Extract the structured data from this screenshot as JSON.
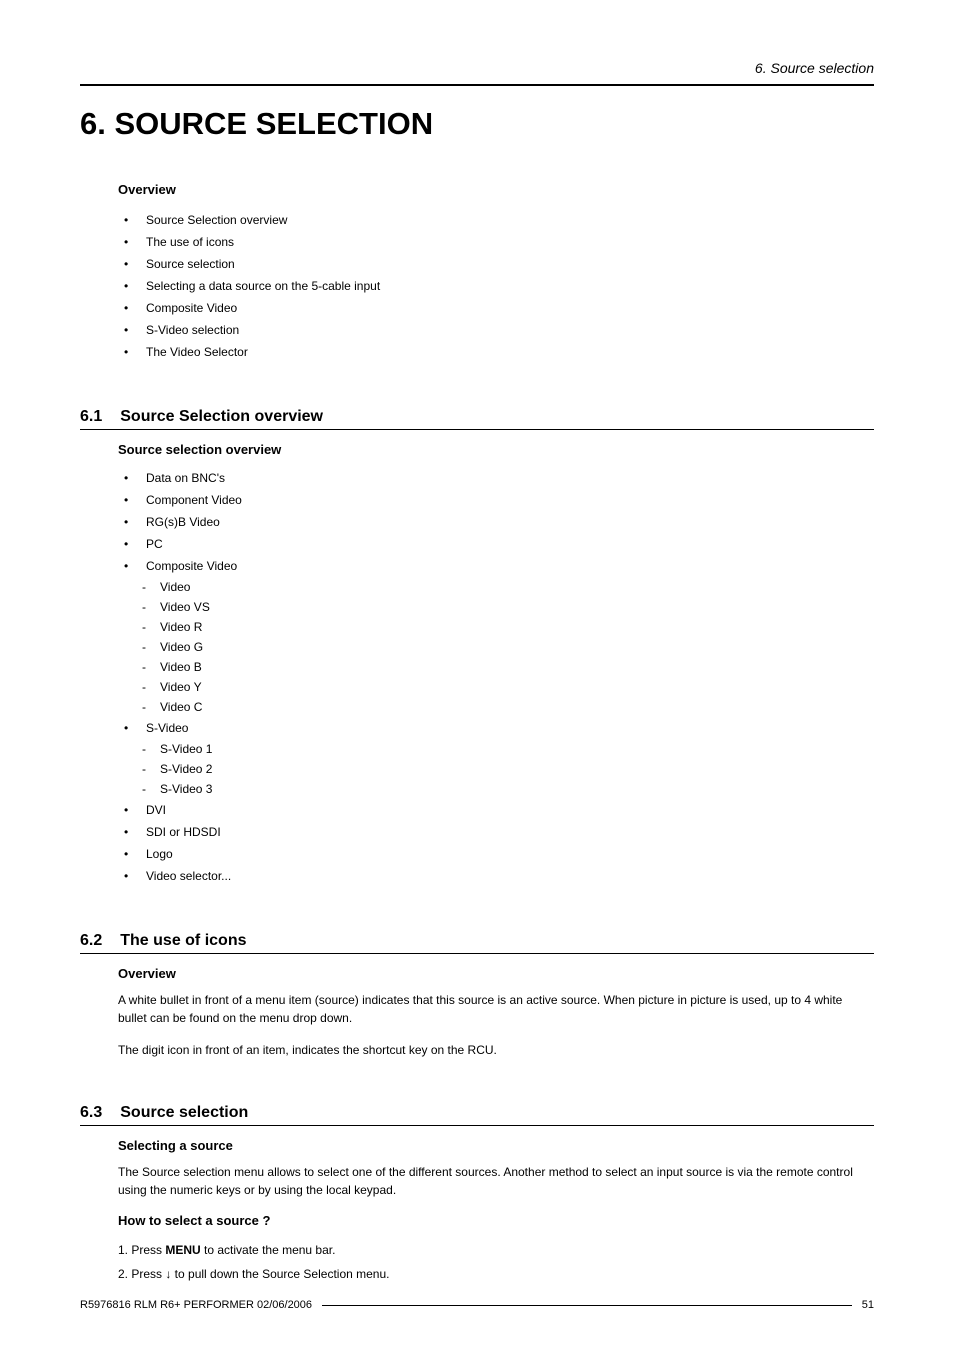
{
  "header": {
    "running_title": "6.  Source selection"
  },
  "chapter": {
    "title": "6. SOURCE SELECTION"
  },
  "overview": {
    "heading": "Overview",
    "items": [
      "Source Selection overview",
      "The use of icons",
      "Source selection",
      "Selecting a data source on the 5-cable input",
      "Composite Video",
      "S-Video selection",
      "The Video Selector"
    ]
  },
  "section_6_1": {
    "number": "6.1",
    "title": "Source Selection overview",
    "subheading": "Source selection overview",
    "items": {
      "i0": "Data on BNC's",
      "i1": "Component Video",
      "i2": "RG(s)B Video",
      "i3": "PC",
      "i4": "Composite Video",
      "i4_sub": {
        "s0": "Video",
        "s1": "Video VS",
        "s2": "Video R",
        "s3": "Video G",
        "s4": "Video B",
        "s5": "Video Y",
        "s6": "Video C"
      },
      "i5": "S-Video",
      "i5_sub": {
        "s0": "S-Video 1",
        "s1": "S-Video 2",
        "s2": "S-Video 3"
      },
      "i6": "DVI",
      "i7": "SDI or HDSDI",
      "i8": "Logo",
      "i9": "Video selector..."
    }
  },
  "section_6_2": {
    "number": "6.2",
    "title": "The use of icons",
    "subheading": "Overview",
    "para1": "A white bullet in front of a menu item (source) indicates that this source is an active source.  When picture in picture is used, up to 4 white bullet can be found on the menu drop down.",
    "para2": "The digit icon in front of an item, indicates the shortcut key on the RCU."
  },
  "section_6_3": {
    "number": "6.3",
    "title": "Source selection",
    "subheading1": "Selecting a source",
    "para1": "The Source selection menu allows to select one of the different sources. Another method to select an input source is via the remote control using the numeric keys or by using the local keypad.",
    "subheading2": "How to select a source ?",
    "step1_prefix": "1.  Press ",
    "step1_bold": "MENU",
    "step1_suffix": " to activate the menu bar.",
    "step2": "2.  Press ↓ to pull down the Source Selection menu."
  },
  "footer": {
    "left": "R5976816  RLM R6+ PERFORMER  02/06/2006",
    "right": "51"
  }
}
